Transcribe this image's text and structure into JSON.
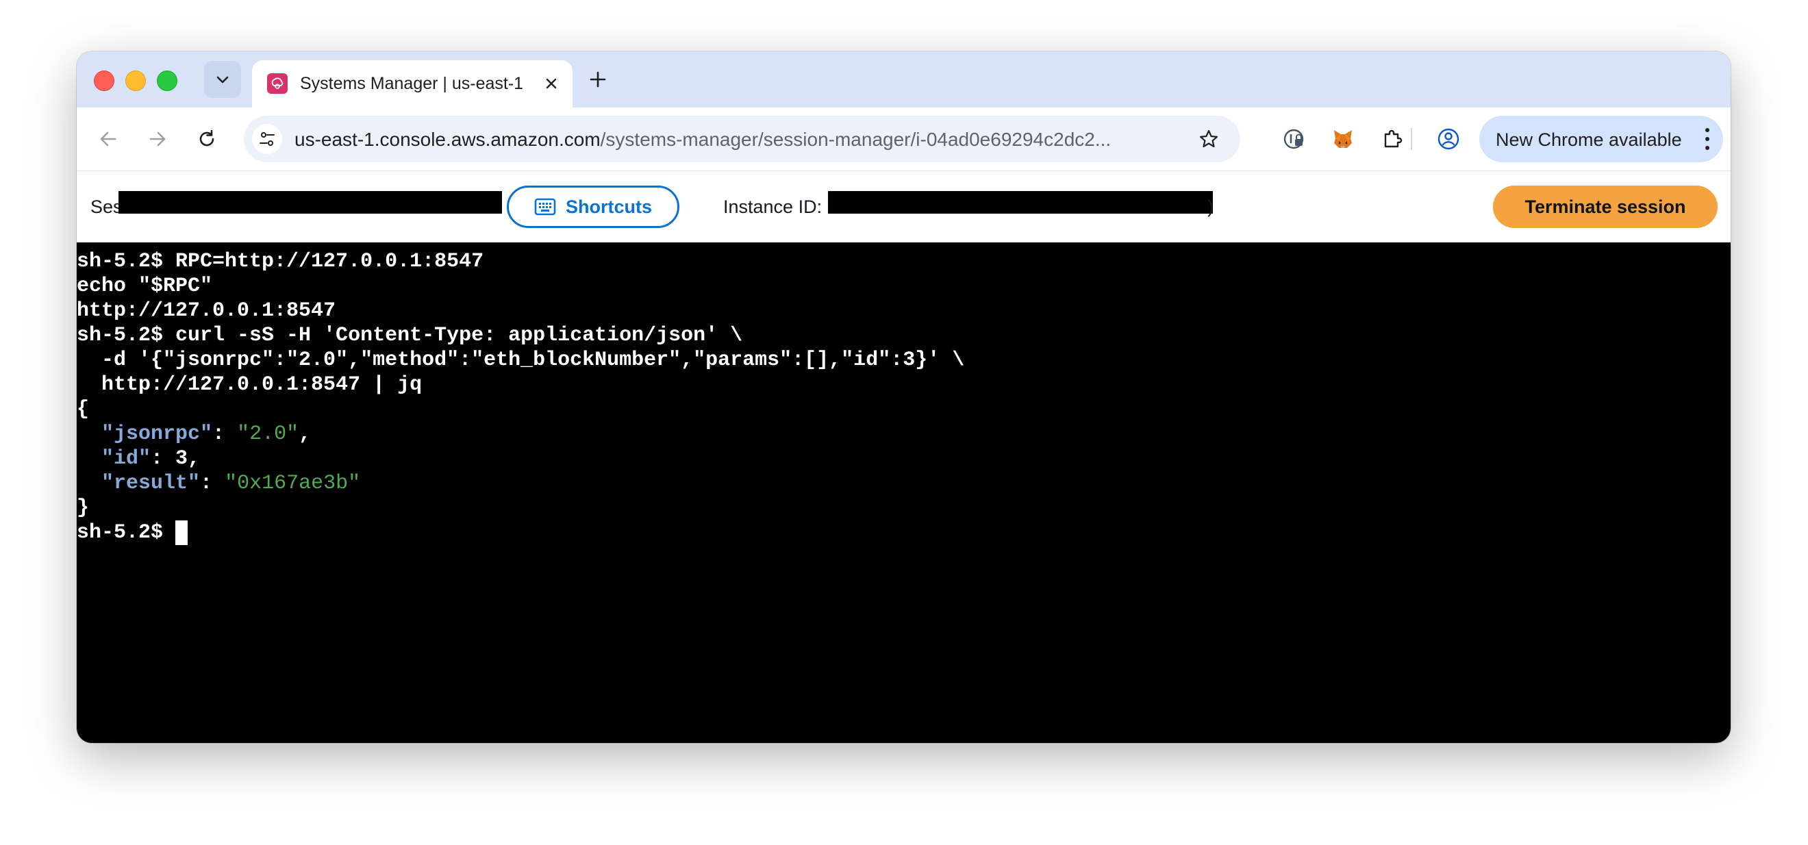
{
  "browser": {
    "tab": {
      "title": "Systems Manager | us-east-1",
      "favicon": "aws-systems-manager-icon"
    },
    "address_bar": {
      "url_host": "us-east-1.console.aws.amazon.com",
      "url_path": "/systems-manager/session-manager/i-04ad0e69294c2dc2..."
    },
    "update_button_label": "New Chrome available"
  },
  "session_bar": {
    "session_label_visible": "Ses",
    "shortcuts_label": "Shortcuts",
    "instance_label": "Instance ID:",
    "instance_suffix": ")",
    "terminate_label": "Terminate session"
  },
  "terminal": {
    "lines": [
      "sh-5.2$ RPC=http://127.0.0.1:8547",
      "echo \"$RPC\"",
      "http://127.0.0.1:8547",
      "sh-5.2$ curl -sS -H 'Content-Type: application/json' \\",
      "  -d '{\"jsonrpc\":\"2.0\",\"method\":\"eth_blockNumber\",\"params\":[],\"id\":3}' \\",
      "  http://127.0.0.1:8547 | jq",
      "{"
    ],
    "json_output": {
      "indent": "  ",
      "entries": [
        {
          "key": "\"jsonrpc\"",
          "sep": ": ",
          "value": "\"2.0\"",
          "value_type": "string",
          "trail": ","
        },
        {
          "key": "\"id\"",
          "sep": ": ",
          "value": "3",
          "value_type": "number",
          "trail": ","
        },
        {
          "key": "\"result\"",
          "sep": ": ",
          "value": "\"0x167ae3b\"",
          "value_type": "string",
          "trail": ""
        }
      ]
    },
    "closing_brace": "}",
    "prompt": "sh-5.2$ "
  },
  "colors": {
    "terminate_button": "#f4a340",
    "shortcuts_accent": "#0972d3",
    "json_key": "#86a8db",
    "json_string": "#4fab4f",
    "terminal_bg": "#000000"
  }
}
